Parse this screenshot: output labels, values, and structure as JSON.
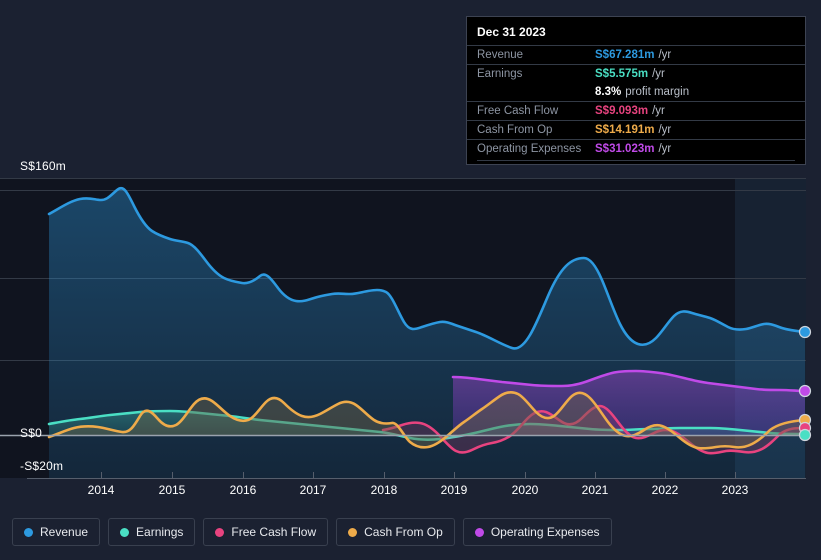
{
  "tooltip": {
    "date": "Dec 31 2023",
    "rows": [
      {
        "key": "Revenue",
        "value": "S$67.281m",
        "suffix": "/yr",
        "color": "#2d9ae0"
      },
      {
        "key": "Earnings",
        "value": "S$5.575m",
        "suffix": "/yr",
        "color": "#4adfc4"
      },
      {
        "key": "",
        "value": "8.3%",
        "suffix": "profit margin",
        "color": "#ffffff"
      },
      {
        "key": "Free Cash Flow",
        "value": "S$9.093m",
        "suffix": "/yr",
        "color": "#e8437f"
      },
      {
        "key": "Cash From Op",
        "value": "S$14.191m",
        "suffix": "/yr",
        "color": "#eeab4a"
      },
      {
        "key": "Operating Expenses",
        "value": "S$31.023m",
        "suffix": "/yr",
        "color": "#c04ae8"
      }
    ]
  },
  "legend": [
    {
      "label": "Revenue",
      "color": "#2d9ae0"
    },
    {
      "label": "Earnings",
      "color": "#4adfc4"
    },
    {
      "label": "Free Cash Flow",
      "color": "#e8437f"
    },
    {
      "label": "Cash From Op",
      "color": "#eeab4a"
    },
    {
      "label": "Operating Expenses",
      "color": "#c04ae8"
    }
  ],
  "axis": {
    "y_top": "S$160m",
    "y_zero": "S$0",
    "y_bottom": "-S$20m",
    "x_ticks": [
      "2014",
      "2015",
      "2016",
      "2017",
      "2018",
      "2019",
      "2020",
      "2021",
      "2022",
      "2023"
    ]
  },
  "chart_data": {
    "type": "area",
    "title": "",
    "xlabel": "",
    "ylabel": "S$",
    "ylim": [
      -20,
      160
    ],
    "grid": true,
    "legend_position": "bottom",
    "currency": "S$",
    "units": "millions",
    "x": [
      2013.5,
      2013.8,
      2014.0,
      2014.3,
      2014.5,
      2014.8,
      2015.0,
      2015.3,
      2015.5,
      2015.8,
      2016.0,
      2016.3,
      2016.5,
      2016.8,
      2017.0,
      2017.3,
      2017.5,
      2017.8,
      2018.0,
      2018.3,
      2018.5,
      2018.8,
      2019.0,
      2019.3,
      2019.5,
      2019.8,
      2020.0,
      2020.3,
      2020.5,
      2020.8,
      2021.0,
      2021.3,
      2021.5,
      2021.8,
      2022.0,
      2022.3,
      2022.5,
      2022.8,
      2023.0,
      2023.3,
      2023.5,
      2023.8,
      2024.0
    ],
    "series": [
      {
        "name": "Revenue",
        "color": "#2d9ae0",
        "end_value": 67.281,
        "values": [
          144,
          150,
          152,
          150,
          155,
          143,
          138,
          133,
          130,
          125,
          122,
          120,
          116,
          115,
          118,
          119,
          118,
          120,
          116,
          100,
          96,
          97,
          95,
          92,
          86,
          80,
          78,
          82,
          96,
          108,
          112,
          104,
          88,
          80,
          78,
          84,
          85,
          83,
          80,
          73,
          70,
          68,
          67.281
        ]
      },
      {
        "name": "Earnings",
        "color": "#4adfc4",
        "end_value": 5.575,
        "values": [
          6,
          7,
          8,
          9,
          10,
          11,
          12,
          12,
          13,
          13,
          13,
          13,
          12,
          12,
          11,
          10,
          9,
          9,
          8,
          7,
          6,
          5,
          3,
          1,
          0,
          0,
          1,
          2,
          4,
          5,
          5,
          4,
          3,
          3,
          4,
          5,
          5,
          5,
          5,
          4,
          4,
          5,
          5.575
        ]
      },
      {
        "name": "Free Cash Flow",
        "color": "#e8437f",
        "end_value": 9.093,
        "start_x": 2017.7,
        "values": [
          null,
          null,
          null,
          null,
          null,
          null,
          null,
          null,
          null,
          null,
          null,
          null,
          null,
          null,
          null,
          null,
          null,
          3,
          4,
          6,
          5,
          4,
          -3,
          -5,
          -4,
          -3,
          0,
          5,
          14,
          10,
          16,
          5,
          -3,
          0,
          3,
          2,
          0,
          -6,
          -5,
          -4,
          1,
          7,
          9.093
        ]
      },
      {
        "name": "Cash From Op",
        "color": "#eeab4a",
        "end_value": 14.191,
        "values": [
          -1,
          1,
          3,
          4,
          3,
          2,
          9,
          5,
          7,
          16,
          11,
          9,
          15,
          10,
          7,
          17,
          14,
          10,
          9,
          8,
          7,
          6,
          -2,
          -4,
          -3,
          -1,
          3,
          9,
          18,
          13,
          19,
          10,
          3,
          7,
          9,
          6,
          4,
          -1,
          0,
          1,
          5,
          11,
          14.191
        ]
      },
      {
        "name": "Operating Expenses",
        "color": "#c04ae8",
        "end_value": 31.023,
        "start_x": 2018.95,
        "values": [
          null,
          null,
          null,
          null,
          null,
          null,
          null,
          null,
          null,
          null,
          null,
          null,
          null,
          null,
          null,
          null,
          null,
          null,
          null,
          null,
          null,
          null,
          34,
          33,
          32,
          31,
          30,
          30,
          30,
          30,
          31,
          34,
          37,
          38,
          38,
          37,
          35,
          34,
          33,
          32,
          31,
          31,
          31.023
        ]
      }
    ]
  }
}
